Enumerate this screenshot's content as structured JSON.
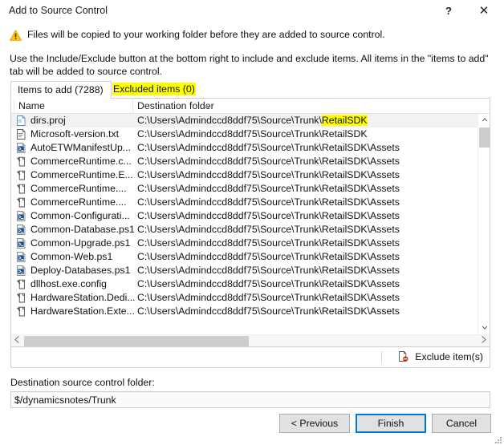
{
  "window": {
    "title": "Add to Source Control",
    "help_label": "?",
    "close_label": "✕"
  },
  "warning": {
    "icon": "warning-triangle-icon",
    "text": "Files will be copied to your working folder before they are added to source control."
  },
  "instructions": {
    "text": "Use the Include/Exclude button at the bottom right to include and exclude items. All items in the \"items to add\" tab will be added to source control."
  },
  "tabs": [
    {
      "label": "Items to add (7288)",
      "active": true,
      "highlighted": false
    },
    {
      "label": "Excluded items (0)",
      "active": false,
      "highlighted": true
    }
  ],
  "list": {
    "columns": [
      {
        "key": "name",
        "label": "Name",
        "sorted": false
      },
      {
        "key": "destination",
        "label": "Destination folder",
        "sorted": true,
        "sort_direction": "ascending"
      }
    ],
    "rows": [
      {
        "icon": "proj-file-icon",
        "name": "dirs.proj",
        "destination_prefix": "C:\\Users\\Admindccd8ddf75\\Source\\Trunk\\",
        "destination_highlight": "RetailSDK",
        "destination_suffix": "",
        "selected": true
      },
      {
        "icon": "text-file-icon",
        "name": "Microsoft-version.txt",
        "destination_prefix": "C:\\Users\\Admindccd8ddf75\\Source\\Trunk\\RetailSDK",
        "destination_highlight": "",
        "destination_suffix": "",
        "selected": false
      },
      {
        "icon": "powershell-file-icon",
        "name": "AutoETWManifestUp...",
        "destination_prefix": "C:\\Users\\Admindccd8ddf75\\Source\\Trunk\\RetailSDK\\Assets",
        "destination_highlight": "",
        "destination_suffix": "",
        "selected": false
      },
      {
        "icon": "config-file-icon",
        "name": "CommerceRuntime.c...",
        "destination_prefix": "C:\\Users\\Admindccd8ddf75\\Source\\Trunk\\RetailSDK\\Assets",
        "destination_highlight": "",
        "destination_suffix": "",
        "selected": false
      },
      {
        "icon": "config-file-icon",
        "name": "CommerceRuntime.E...",
        "destination_prefix": "C:\\Users\\Admindccd8ddf75\\Source\\Trunk\\RetailSDK\\Assets",
        "destination_highlight": "",
        "destination_suffix": "",
        "selected": false
      },
      {
        "icon": "config-file-icon",
        "name": "CommerceRuntime....",
        "destination_prefix": "C:\\Users\\Admindccd8ddf75\\Source\\Trunk\\RetailSDK\\Assets",
        "destination_highlight": "",
        "destination_suffix": "",
        "selected": false
      },
      {
        "icon": "config-file-icon",
        "name": "CommerceRuntime....",
        "destination_prefix": "C:\\Users\\Admindccd8ddf75\\Source\\Trunk\\RetailSDK\\Assets",
        "destination_highlight": "",
        "destination_suffix": "",
        "selected": false
      },
      {
        "icon": "powershell-file-icon",
        "name": "Common-Configurati...",
        "destination_prefix": "C:\\Users\\Admindccd8ddf75\\Source\\Trunk\\RetailSDK\\Assets",
        "destination_highlight": "",
        "destination_suffix": "",
        "selected": false
      },
      {
        "icon": "powershell-file-icon",
        "name": "Common-Database.ps1",
        "destination_prefix": "C:\\Users\\Admindccd8ddf75\\Source\\Trunk\\RetailSDK\\Assets",
        "destination_highlight": "",
        "destination_suffix": "",
        "selected": false
      },
      {
        "icon": "powershell-file-icon",
        "name": "Common-Upgrade.ps1",
        "destination_prefix": "C:\\Users\\Admindccd8ddf75\\Source\\Trunk\\RetailSDK\\Assets",
        "destination_highlight": "",
        "destination_suffix": "",
        "selected": false
      },
      {
        "icon": "powershell-file-icon",
        "name": "Common-Web.ps1",
        "destination_prefix": "C:\\Users\\Admindccd8ddf75\\Source\\Trunk\\RetailSDK\\Assets",
        "destination_highlight": "",
        "destination_suffix": "",
        "selected": false
      },
      {
        "icon": "powershell-file-icon",
        "name": "Deploy-Databases.ps1",
        "destination_prefix": "C:\\Users\\Admindccd8ddf75\\Source\\Trunk\\RetailSDK\\Assets",
        "destination_highlight": "",
        "destination_suffix": "",
        "selected": false
      },
      {
        "icon": "config-file-icon",
        "name": "dllhost.exe.config",
        "destination_prefix": "C:\\Users\\Admindccd8ddf75\\Source\\Trunk\\RetailSDK\\Assets",
        "destination_highlight": "",
        "destination_suffix": "",
        "selected": false
      },
      {
        "icon": "config-file-icon",
        "name": "HardwareStation.Dedi...",
        "destination_prefix": "C:\\Users\\Admindccd8ddf75\\Source\\Trunk\\RetailSDK\\Assets",
        "destination_highlight": "",
        "destination_suffix": "",
        "selected": false
      },
      {
        "icon": "config-file-icon",
        "name": "HardwareStation.Exte...",
        "destination_prefix": "C:\\Users\\Admindccd8ddf75\\Source\\Trunk\\RetailSDK\\Assets",
        "destination_highlight": "",
        "destination_suffix": "",
        "selected": false
      }
    ]
  },
  "scrollbars": {
    "vertical_up": "▲",
    "vertical_down": "▼",
    "horizontal_left": "‹",
    "horizontal_right": "›"
  },
  "exclude": {
    "label": "Exclude item(s)",
    "icon": "exclude-item-icon"
  },
  "destination_field": {
    "label": "Destination source control folder:",
    "value": "$/dynamicsnotes/Trunk",
    "placeholder": ""
  },
  "footer": {
    "previous_label": "< Previous",
    "finish_label": "Finish",
    "cancel_label": "Cancel"
  },
  "colors": {
    "highlight_yellow": "#ffff00",
    "focus_blue": "#0078d7",
    "selected_row": "#f2f2f2",
    "warning_amber": "#ffc20e",
    "exclude_red": "#c0392b"
  }
}
